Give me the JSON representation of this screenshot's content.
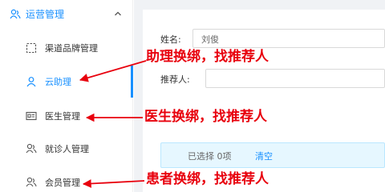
{
  "sidebar": {
    "group_label": "运营管理",
    "items": [
      {
        "label": "渠道品牌管理",
        "icon": "dashed-square-icon"
      },
      {
        "label": "云助理",
        "icon": "person-icon"
      },
      {
        "label": "医生管理",
        "icon": "id-card-icon"
      },
      {
        "label": "就诊人管理",
        "icon": "users-icon"
      },
      {
        "label": "会员管理",
        "icon": "users-icon"
      }
    ]
  },
  "form": {
    "name_label": "姓名:",
    "name_value": "刘俊",
    "referrer_label": "推荐人:",
    "referrer_value": ""
  },
  "selection": {
    "text": "已选择 0项",
    "clear": "清空"
  },
  "callouts": {
    "assistant": "助理换绑，找推荐人",
    "doctor": "医生换绑，找推荐人",
    "patient": "患者换绑，找推荐人"
  },
  "colors": {
    "accent": "#1890ff",
    "annotation": "#e8000d"
  }
}
